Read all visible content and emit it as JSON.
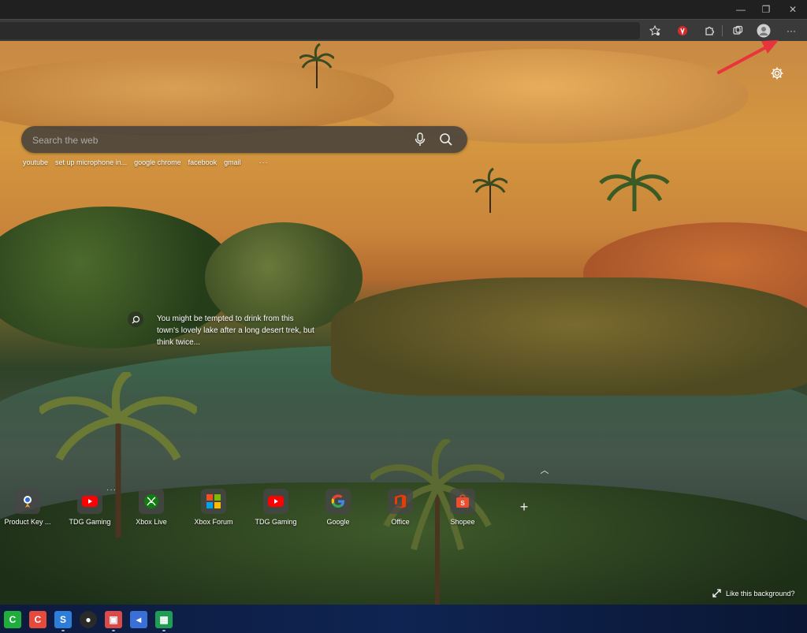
{
  "window": {
    "minimize_glyph": "—",
    "restore_glyph": "❐",
    "close_glyph": "✕"
  },
  "toolbar": {
    "icons": [
      "favorites-star-icon",
      "vivaldi-extension-icon",
      "extensions-puzzle-icon",
      "collections-icon",
      "profile-avatar-icon",
      "more-menu-icon"
    ],
    "more_glyph": "···"
  },
  "search": {
    "placeholder": "Search the web"
  },
  "chips": [
    "youtube",
    "set up microphone in...",
    "google chrome",
    "facebook",
    "gmail",
    "···"
  ],
  "caption": {
    "text": "You might be tempted to drink from this town's lovely lake after a long desert trek, but think twice..."
  },
  "quick_links": [
    {
      "label": "Product Key ...",
      "icon": "product-key-icon"
    },
    {
      "label": "TDG Gaming",
      "icon": "youtube-icon"
    },
    {
      "label": "Xbox Live",
      "icon": "xbox-icon"
    },
    {
      "label": "Xbox Forum",
      "icon": "microsoft-icon"
    },
    {
      "label": "TDG Gaming",
      "icon": "youtube-icon"
    },
    {
      "label": "Google",
      "icon": "google-icon"
    },
    {
      "label": "Office",
      "icon": "office-icon"
    },
    {
      "label": "Shopee",
      "icon": "shopee-icon"
    }
  ],
  "tile_more_glyph": "···",
  "chevron_glyph": "︿",
  "add_glyph": "+",
  "like_background": "Like this background?",
  "taskbar": {
    "apps": [
      {
        "name": "camtasia-icon",
        "glyph": "C",
        "color": "#1fae3e"
      },
      {
        "name": "snagit-recorder-icon",
        "glyph": "C",
        "color": "#e54b3c"
      },
      {
        "name": "snagit-icon",
        "glyph": "S",
        "color": "#2d7ed8"
      },
      {
        "name": "obs-icon",
        "glyph": "●",
        "color": "#2a2a2a"
      },
      {
        "name": "paint-icon",
        "glyph": "▣",
        "color": "#d94a4a"
      },
      {
        "name": "media-encoder-icon",
        "glyph": "◂",
        "color": "#3a6fd8"
      },
      {
        "name": "sheets-icon",
        "glyph": "▦",
        "color": "#1f9d55"
      }
    ]
  },
  "colors": {
    "annotation_arrow": "#e8343c",
    "titlebar": "#202020",
    "toolbar": "#3a3a3a"
  }
}
